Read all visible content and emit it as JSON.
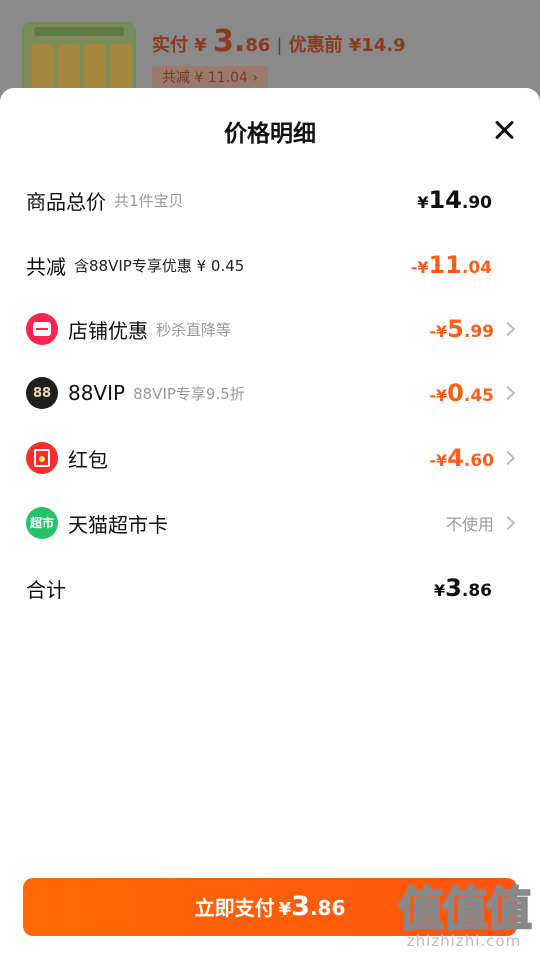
{
  "background_header": {
    "pay_prefix": "实付 ¥ ",
    "pay_int": "3.",
    "pay_dec": "86",
    "sep": "|",
    "orig_label": "优惠前 ¥14.9",
    "save_badge": "共减 ¥ 11.04 ›"
  },
  "sheet": {
    "title": "价格明细",
    "close_icon": "close-icon",
    "rows": {
      "total": {
        "label": "商品总价",
        "sub": "共1件宝贝",
        "yen": "¥",
        "int": "14",
        "dec": ".90"
      },
      "discount": {
        "label": "共减",
        "sub": "含88VIP专享优惠 ¥ 0.45",
        "yen": "-¥",
        "int": "11",
        "dec": ".04"
      },
      "shop": {
        "icon": "shop-icon",
        "label": "店铺优惠",
        "sub": "秒杀直降等",
        "yen": "-¥",
        "int": "5",
        "dec": ".99"
      },
      "vip": {
        "icon": "88vip-icon",
        "icon_text": "88",
        "label": "88VIP",
        "sub": "88VIP专享9.5折",
        "yen": "-¥",
        "int": "0",
        "dec": ".45"
      },
      "redpack": {
        "icon": "red-packet-icon",
        "label": "红包",
        "yen": "-¥",
        "int": "4",
        "dec": ".60"
      },
      "mart": {
        "icon": "tmall-mart-icon",
        "icon_text": "超市",
        "label": "天猫超市卡",
        "value": "不使用"
      },
      "sum": {
        "label": "合计",
        "yen": "¥",
        "int": "3",
        "dec": ".86"
      }
    }
  },
  "pay_button": {
    "label": "立即支付",
    "yen": "¥",
    "int": "3",
    "dec": ".86"
  },
  "watermark": {
    "big": "值值值",
    "small": "zhizhizhi.com"
  },
  "colors": {
    "accent": "#ff5d17",
    "button": "#ff6a00"
  }
}
